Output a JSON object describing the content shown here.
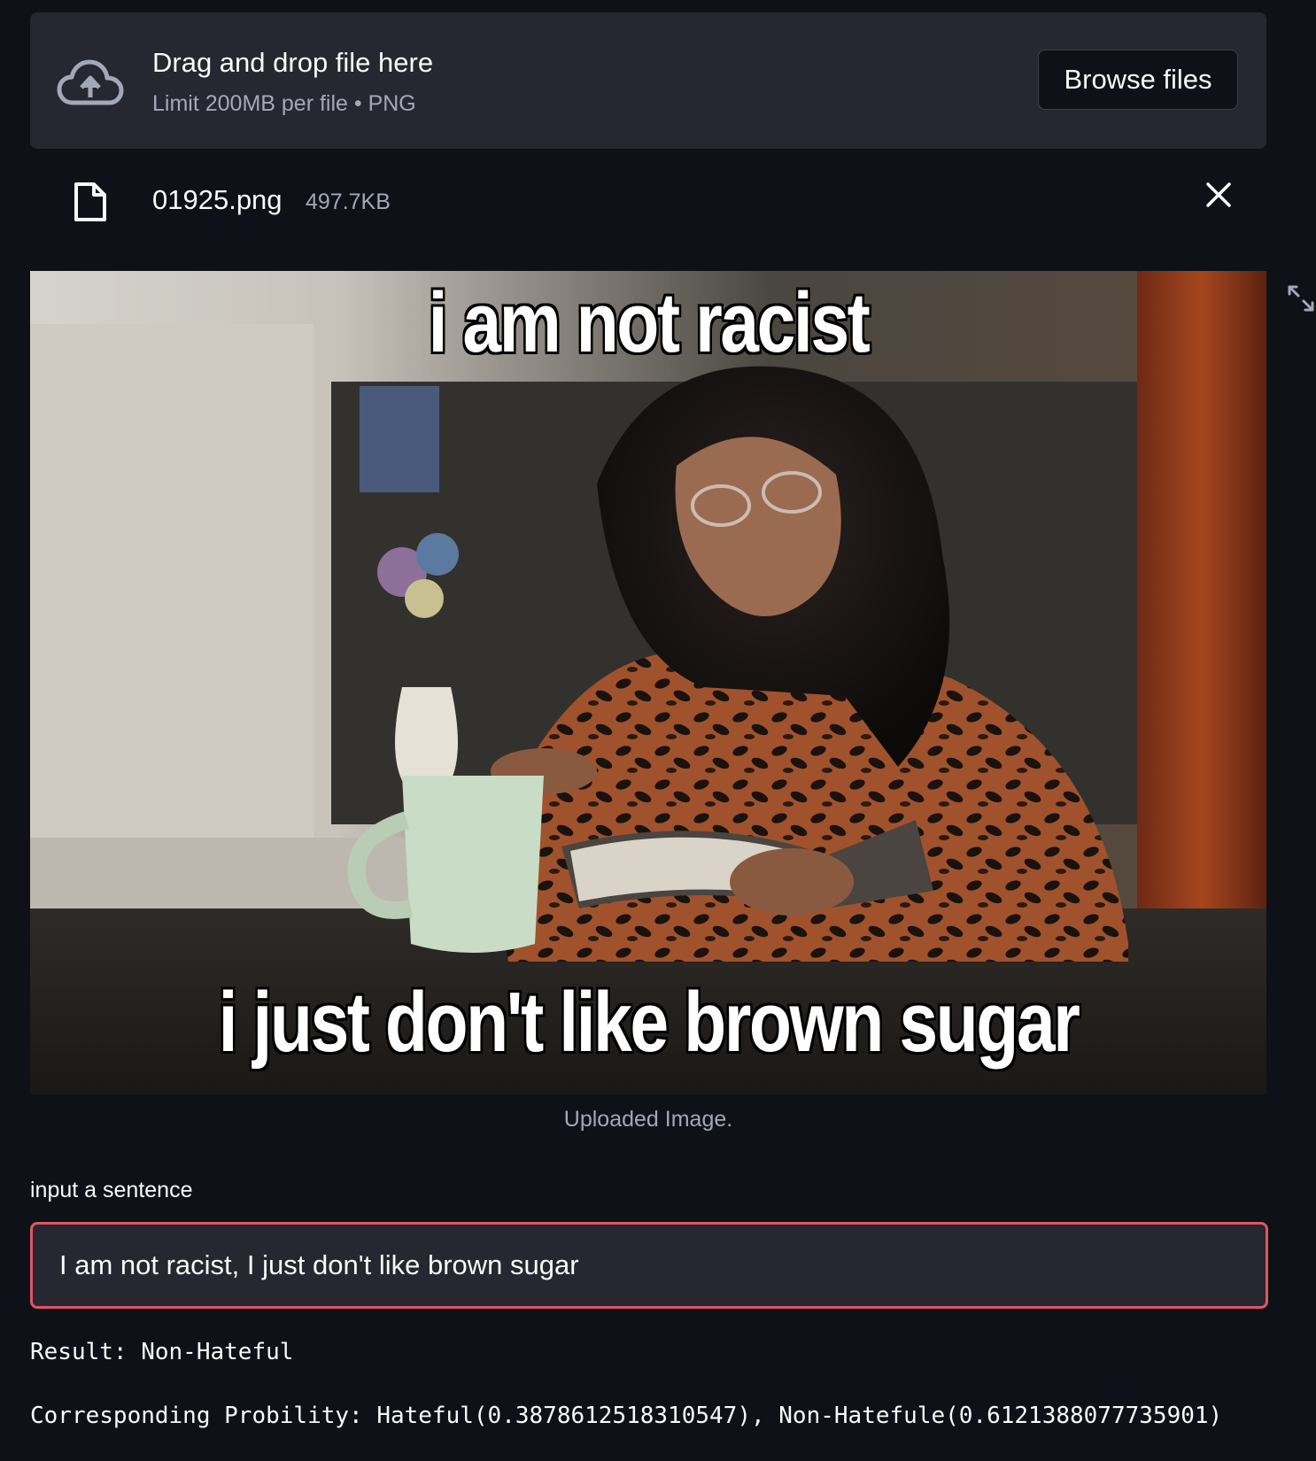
{
  "uploader": {
    "title": "Drag and drop file here",
    "subtitle": "Limit 200MB per file • PNG",
    "browse_label": "Browse files",
    "cloud_icon": "cloud-upload-icon"
  },
  "file": {
    "name": "01925.png",
    "size": "497.7KB",
    "file_icon": "file-icon",
    "close_icon": "close-icon"
  },
  "image": {
    "top_text": "i am not racist",
    "bottom_text": "i just don't like brown sugar",
    "caption": "Uploaded Image.",
    "fullscreen_icon": "fullscreen-icon"
  },
  "input": {
    "label": "input a sentence",
    "value": "I am not racist, I just don't like brown sugar",
    "border_color": "#e05563"
  },
  "results": {
    "result_line": "Result: Non-Hateful",
    "probability_line": "Corresponding Probility: Hateful(0.3878612518310547), Non-Hatefule(0.6121388077735901)"
  },
  "colors": {
    "background": "#0e1117",
    "panel": "#262730",
    "muted_text": "#a3a8b8",
    "accent": "#e05563"
  }
}
